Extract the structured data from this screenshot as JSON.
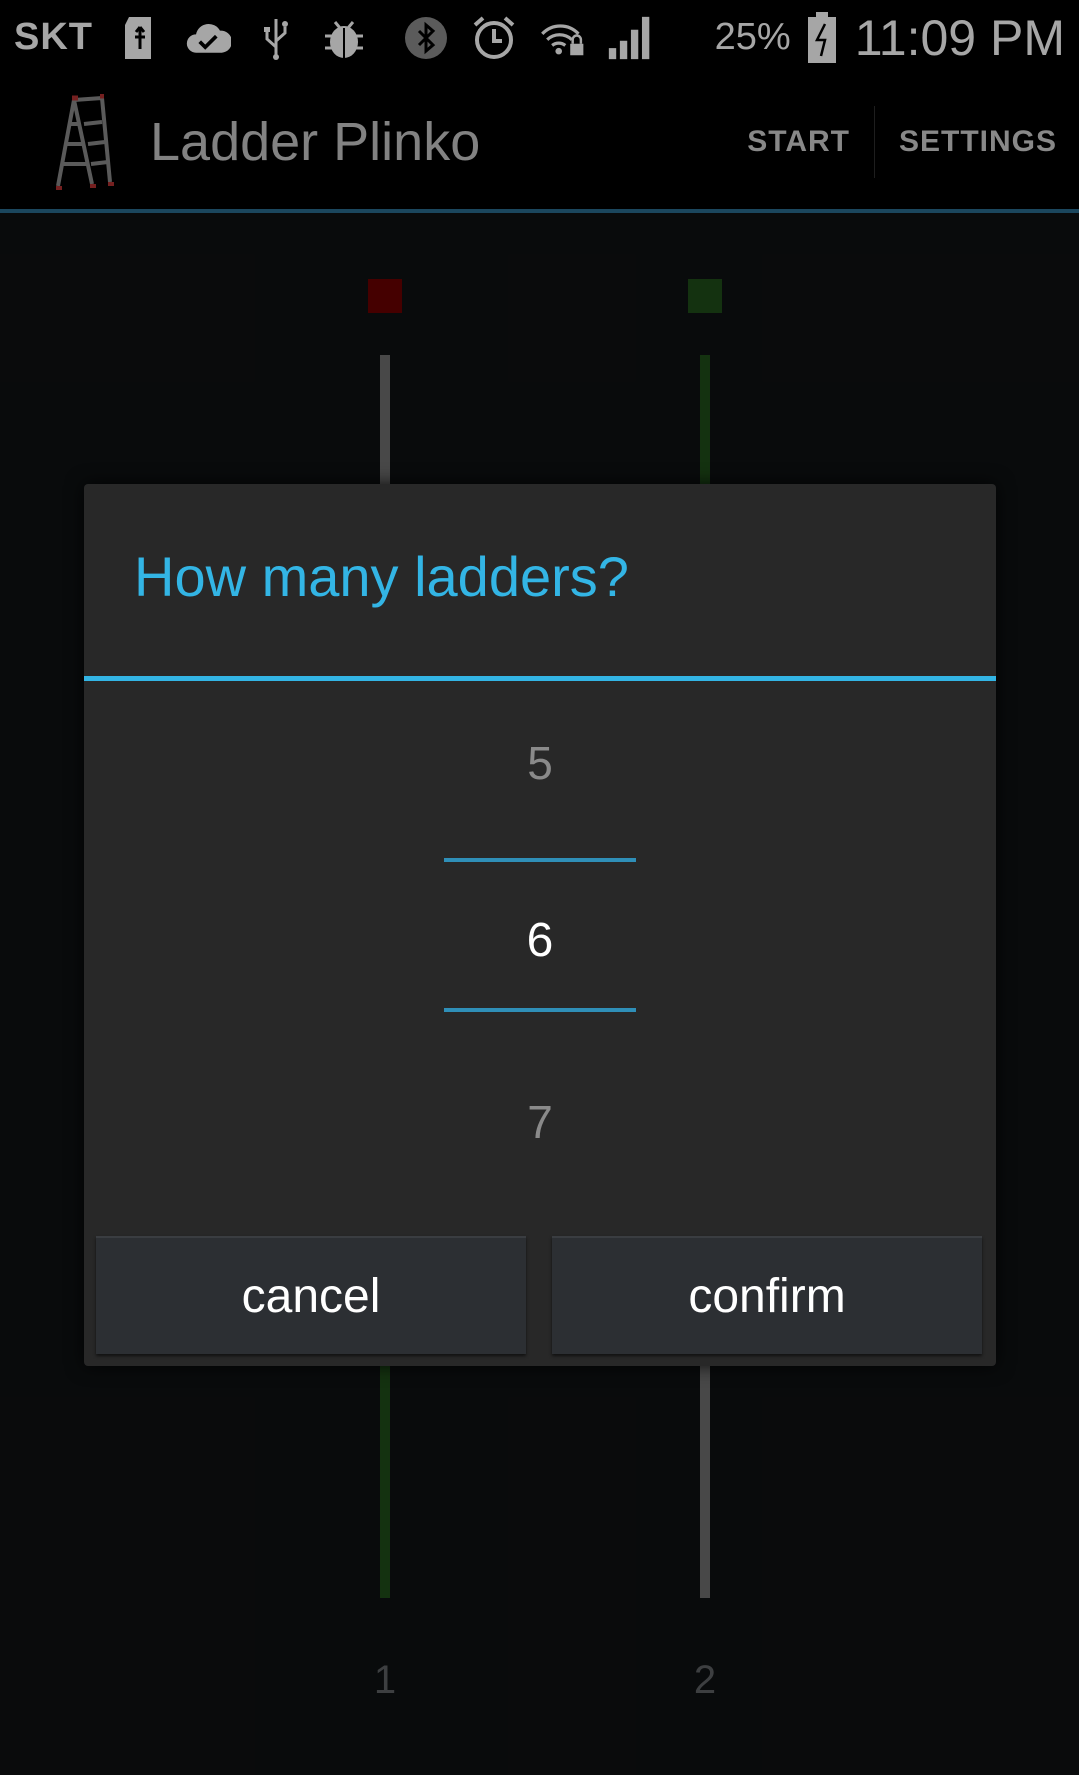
{
  "status_bar": {
    "carrier": "SKT",
    "battery_percent": "25%",
    "time": "11:09 PM",
    "icons": [
      "sd-card-icon",
      "cloud-check-icon",
      "usb-icon",
      "debug-bug-icon",
      "bluetooth-icon",
      "alarm-icon",
      "wifi-lock-icon",
      "signal-icon",
      "battery-charging-icon"
    ]
  },
  "action_bar": {
    "title": "Ladder Plinko",
    "start_label": "START",
    "settings_label": "SETTINGS"
  },
  "board": {
    "columns": [
      {
        "label": "1",
        "top_marker_color": "#6b0000",
        "top_rail_color": "#6f6f6f",
        "bottom_rail_color": "#1f4d19"
      },
      {
        "label": "2",
        "top_marker_color": "#1f4d19",
        "top_rail_color": "#1f4d19",
        "bottom_rail_color": "#6f6f6f"
      }
    ]
  },
  "dialog": {
    "title": "How many ladders?",
    "picker": {
      "previous": "5",
      "selected": "6",
      "next": "7"
    },
    "cancel_label": "cancel",
    "confirm_label": "confirm"
  },
  "colors": {
    "accent": "#33b5e5",
    "divider": "#2a6d91",
    "background": "#0f1113"
  }
}
